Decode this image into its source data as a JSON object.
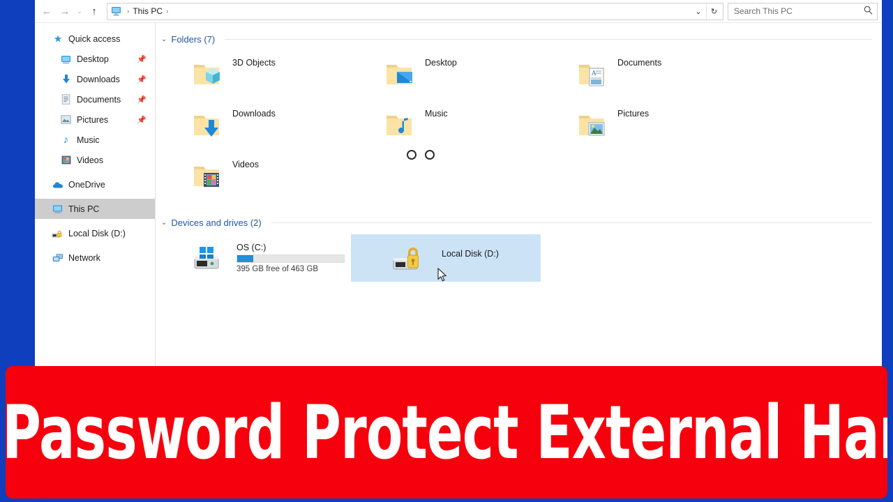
{
  "window": {
    "title": "This PC",
    "frame_color": "#0f3fbd",
    "background": "#ffffff"
  },
  "toolbar": {
    "back_icon": "back-arrow-icon",
    "forward_icon": "forward-arrow-icon",
    "recent_icon": "chevron-down-icon",
    "up_icon": "up-arrow-icon",
    "back_glyph": "←",
    "forward_glyph": "→",
    "recent_glyph": "⌄",
    "up_glyph": "↑",
    "address": {
      "root_icon": "this-pc-icon",
      "crumb": "This PC",
      "separator": "›",
      "dropdown_glyph": "⌄",
      "refresh_glyph": "↻"
    },
    "search": {
      "placeholder": "Search This PC",
      "value": "",
      "icon": "search-icon",
      "glyph": "⌕"
    }
  },
  "sidebar": {
    "items": [
      {
        "label": "Quick access",
        "icon": "star-icon",
        "glyph": "★",
        "color": "#2f9fd8",
        "level": "root",
        "pinned": false,
        "selected": false
      },
      {
        "label": "Desktop",
        "icon": "desktop-icon",
        "glyph": "▣",
        "color": "#3399dd",
        "level": "child",
        "pinned": true,
        "selected": false
      },
      {
        "label": "Downloads",
        "icon": "download-icon",
        "glyph": "⬇",
        "color": "#1f86d8",
        "level": "child",
        "pinned": true,
        "selected": false
      },
      {
        "label": "Documents",
        "icon": "document-icon",
        "glyph": "὜e",
        "color": "#8fa9bf",
        "level": "child",
        "pinned": true,
        "selected": false
      },
      {
        "label": "Pictures",
        "icon": "picture-icon",
        "glyph": "▤",
        "color": "#7a9bb5",
        "level": "child",
        "pinned": true,
        "selected": false
      },
      {
        "label": "Music",
        "icon": "music-note-icon",
        "glyph": "♪",
        "color": "#1f86d8",
        "level": "child",
        "pinned": false,
        "selected": false
      },
      {
        "label": "Videos",
        "icon": "video-icon",
        "glyph": "▦",
        "color": "#6b7fa0",
        "level": "child",
        "pinned": false,
        "selected": false
      },
      {
        "label": "OneDrive",
        "icon": "cloud-icon",
        "glyph": "☁",
        "color": "#1f86d8",
        "level": "root",
        "pinned": false,
        "selected": false
      },
      {
        "label": "This PC",
        "icon": "this-pc-icon",
        "glyph": "▣",
        "color": "#3399dd",
        "level": "root",
        "pinned": false,
        "selected": true
      },
      {
        "label": "Local Disk (D:)",
        "icon": "locked-drive-icon",
        "glyph": "⛁",
        "color": "#d8a52a",
        "level": "root",
        "pinned": false,
        "selected": false
      },
      {
        "label": "Network",
        "icon": "network-icon",
        "glyph": "⬚",
        "color": "#3b7dc4",
        "level": "root",
        "pinned": false,
        "selected": false
      }
    ]
  },
  "main": {
    "groups": [
      {
        "name": "folders-group",
        "title": "Folders (7)",
        "expanded": true,
        "chevron_glyph": "⌄",
        "items": [
          {
            "label": "3D Objects",
            "icon": "folder-3d-objects-icon",
            "badge": "cube"
          },
          {
            "label": "Desktop",
            "icon": "folder-desktop-icon",
            "badge": "monitor"
          },
          {
            "label": "Documents",
            "icon": "folder-documents-icon",
            "badge": "document"
          },
          {
            "label": "Downloads",
            "icon": "folder-downloads-icon",
            "badge": "down-arrow"
          },
          {
            "label": "Music",
            "icon": "folder-music-icon",
            "badge": "note"
          },
          {
            "label": "Pictures",
            "icon": "folder-pictures-icon",
            "badge": "photo"
          },
          {
            "label": "Videos",
            "icon": "folder-videos-icon",
            "badge": "film"
          }
        ]
      },
      {
        "name": "devices-group",
        "title": "Devices and drives (2)",
        "expanded": true,
        "chevron_glyph": "⌄",
        "drives": [
          {
            "label": "OS (C:)",
            "icon": "windows-drive-icon",
            "selected": false,
            "has_bar": true,
            "used_percent": 15,
            "free_text": "395 GB free of 463 GB",
            "bar_color": "#1e90d8"
          },
          {
            "label": "Local Disk (D:)",
            "icon": "locked-drive-icon",
            "selected": true,
            "has_bar": false,
            "used_percent": 0,
            "free_text": "",
            "bar_color": ""
          }
        ]
      }
    ],
    "annotation_circles": 2,
    "cursor": "arrow-pointer"
  },
  "banner": {
    "text": "How to Password Protect External Hard Drive",
    "background": "#f5000c",
    "text_color": "#ffffff"
  }
}
